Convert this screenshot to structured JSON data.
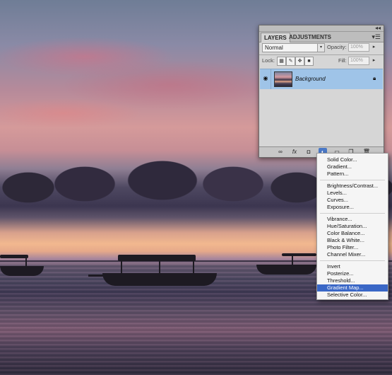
{
  "layers_panel": {
    "tabs": [
      "LAYERS",
      "ADJUSTMENTS"
    ],
    "blend_mode": "Normal",
    "opacity_label": "Opacity:",
    "opacity_value": "100%",
    "lock_label": "Lock:",
    "fill_label": "Fill:",
    "fill_value": "100%",
    "layers": [
      {
        "name": "Background",
        "visible": true,
        "locked": true,
        "selected": true
      }
    ],
    "bottom_icons": [
      "link-icon",
      "fx-icon",
      "mask-icon",
      "adjustment-layer-icon",
      "group-folder-icon",
      "new-layer-icon",
      "trash-icon"
    ],
    "bottom_fx_text": "fx"
  },
  "adjustment_menu": {
    "groups": [
      [
        "Solid Color...",
        "Gradient...",
        "Pattern..."
      ],
      [
        "Brightness/Contrast...",
        "Levels...",
        "Curves...",
        "Exposure..."
      ],
      [
        "Vibrance...",
        "Hue/Saturation...",
        "Color Balance...",
        "Black & White...",
        "Photo Filter...",
        "Channel Mixer..."
      ],
      [
        "Invert",
        "Posterize...",
        "Threshold...",
        "Gradient Map...",
        "Selective Color..."
      ]
    ],
    "highlighted": "Gradient Map..."
  },
  "colors": {
    "selection_blue": "#3a67c6",
    "layer_selected": "#9fc4e8",
    "panel_bg": "#d6d6d6"
  }
}
